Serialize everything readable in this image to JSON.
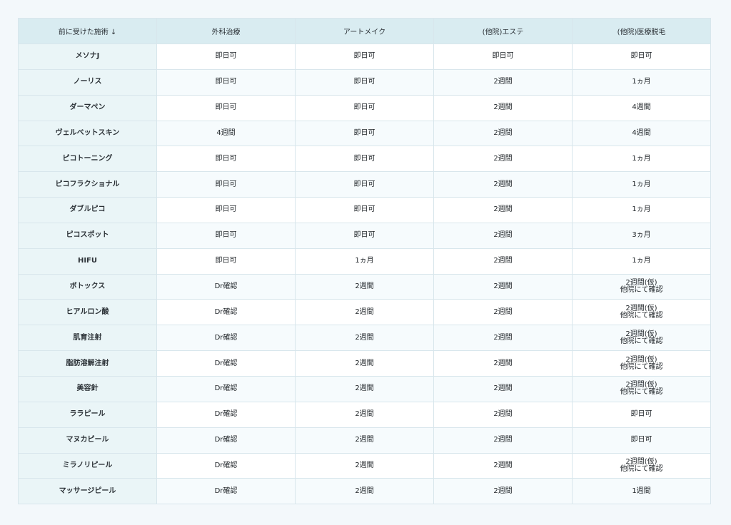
{
  "table": {
    "headers": [
      "前に受けた施術 ↓",
      "外科治療",
      "アートメイク",
      "(他院)エステ",
      "(他院)医療脱毛"
    ],
    "rows": [
      {
        "label": "メソナJ",
        "cells": [
          [
            "即日可"
          ],
          [
            "即日可"
          ],
          [
            "即日可"
          ],
          [
            "即日可"
          ]
        ]
      },
      {
        "label": "ノーリス",
        "cells": [
          [
            "即日可"
          ],
          [
            "即日可"
          ],
          [
            "2週間"
          ],
          [
            "1ヵ月"
          ]
        ]
      },
      {
        "label": "ダーマペン",
        "cells": [
          [
            "即日可"
          ],
          [
            "即日可"
          ],
          [
            "2週間"
          ],
          [
            "4週間"
          ]
        ]
      },
      {
        "label": "ヴェルベットスキン",
        "cells": [
          [
            "4週間"
          ],
          [
            "即日可"
          ],
          [
            "2週間"
          ],
          [
            "4週間"
          ]
        ]
      },
      {
        "label": "ピコトーニング",
        "cells": [
          [
            "即日可"
          ],
          [
            "即日可"
          ],
          [
            "2週間"
          ],
          [
            "1ヵ月"
          ]
        ]
      },
      {
        "label": "ピコフラクショナル",
        "cells": [
          [
            "即日可"
          ],
          [
            "即日可"
          ],
          [
            "2週間"
          ],
          [
            "1ヵ月"
          ]
        ]
      },
      {
        "label": "ダブルピコ",
        "cells": [
          [
            "即日可"
          ],
          [
            "即日可"
          ],
          [
            "2週間"
          ],
          [
            "1ヵ月"
          ]
        ]
      },
      {
        "label": "ピコスポット",
        "cells": [
          [
            "即日可"
          ],
          [
            "即日可"
          ],
          [
            "2週間"
          ],
          [
            "3ヵ月"
          ]
        ]
      },
      {
        "label": "HIFU",
        "cells": [
          [
            "即日可"
          ],
          [
            "1ヵ月"
          ],
          [
            "2週間"
          ],
          [
            "1ヵ月"
          ]
        ]
      },
      {
        "label": "ボトックス",
        "cells": [
          [
            "Dr確認"
          ],
          [
            "2週間"
          ],
          [
            "2週間"
          ],
          [
            "2週間(仮)",
            "他院にて確認"
          ]
        ]
      },
      {
        "label": "ヒアルロン酸",
        "cells": [
          [
            "Dr確認"
          ],
          [
            "2週間"
          ],
          [
            "2週間"
          ],
          [
            "2週間(仮)",
            "他院にて確認"
          ]
        ]
      },
      {
        "label": "肌育注射",
        "cells": [
          [
            "Dr確認"
          ],
          [
            "2週間"
          ],
          [
            "2週間"
          ],
          [
            "2週間(仮)",
            "他院にて確認"
          ]
        ]
      },
      {
        "label": "脂肪溶解注射",
        "cells": [
          [
            "Dr確認"
          ],
          [
            "2週間"
          ],
          [
            "2週間"
          ],
          [
            "2週間(仮)",
            "他院にて確認"
          ]
        ]
      },
      {
        "label": "美容針",
        "cells": [
          [
            "Dr確認"
          ],
          [
            "2週間"
          ],
          [
            "2週間"
          ],
          [
            "2週間(仮)",
            "他院にて確認"
          ]
        ]
      },
      {
        "label": "ララピール",
        "cells": [
          [
            "Dr確認"
          ],
          [
            "2週間"
          ],
          [
            "2週間"
          ],
          [
            "即日可"
          ]
        ]
      },
      {
        "label": "マヌカピール",
        "cells": [
          [
            "Dr確認"
          ],
          [
            "2週間"
          ],
          [
            "2週間"
          ],
          [
            "即日可"
          ]
        ]
      },
      {
        "label": "ミラノリピール",
        "cells": [
          [
            "Dr確認"
          ],
          [
            "2週間"
          ],
          [
            "2週間"
          ],
          [
            "2週間(仮)",
            "他院にて確認"
          ]
        ]
      },
      {
        "label": "マッサージピール",
        "cells": [
          [
            "Dr確認"
          ],
          [
            "2週間"
          ],
          [
            "2週間"
          ],
          [
            "1週間"
          ]
        ]
      }
    ]
  }
}
